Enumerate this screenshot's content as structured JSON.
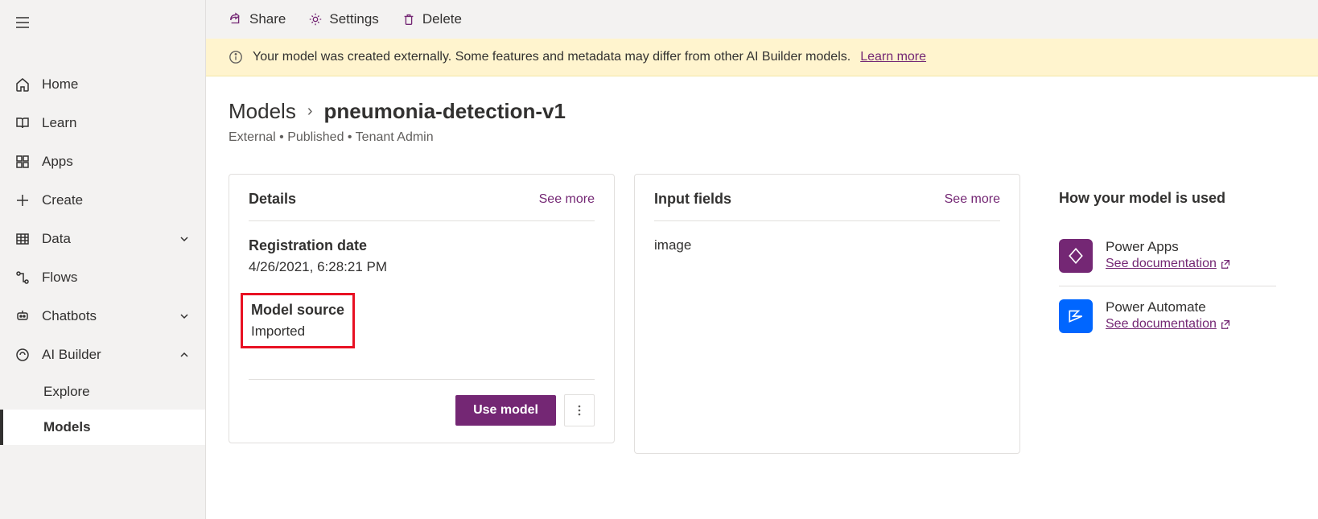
{
  "sidebar": {
    "items": [
      {
        "label": "Home"
      },
      {
        "label": "Learn"
      },
      {
        "label": "Apps"
      },
      {
        "label": "Create"
      },
      {
        "label": "Data"
      },
      {
        "label": "Flows"
      },
      {
        "label": "Chatbots"
      },
      {
        "label": "AI Builder"
      }
    ],
    "ai_builder_sub": [
      {
        "label": "Explore"
      },
      {
        "label": "Models"
      }
    ]
  },
  "toolbar": {
    "share": "Share",
    "settings": "Settings",
    "delete": "Delete"
  },
  "infobar": {
    "text": "Your model was created externally. Some features and metadata may differ from other AI Builder models.",
    "link": "Learn more"
  },
  "breadcrumb": {
    "root": "Models",
    "current": "pneumonia-detection-v1"
  },
  "meta": "External • Published • Tenant Admin",
  "details": {
    "title": "Details",
    "see_more": "See more",
    "reg_label": "Registration date",
    "reg_value": "4/26/2021, 6:28:21 PM",
    "src_label": "Model source",
    "src_value": "Imported",
    "use_model": "Use model"
  },
  "inputs": {
    "title": "Input fields",
    "see_more": "See more",
    "field": "image"
  },
  "usage": {
    "title": "How your model is used",
    "power_apps": "Power Apps",
    "power_automate": "Power Automate",
    "doc_link": "See documentation"
  }
}
